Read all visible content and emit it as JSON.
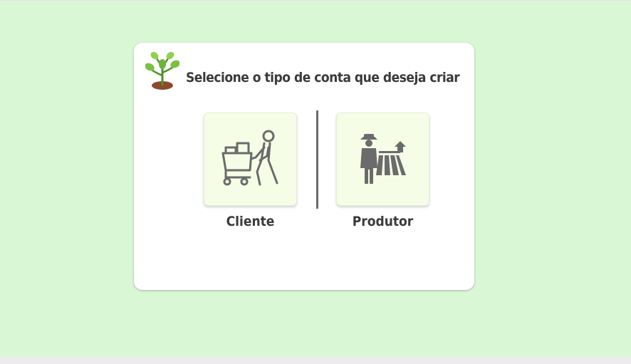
{
  "screen": {
    "title": "Selecione o tipo de conta que deseja criar",
    "options": [
      {
        "label": "Cliente",
        "icon": "shopping-cart-person-icon"
      },
      {
        "label": "Produtor",
        "icon": "farmer-icon"
      }
    ]
  },
  "colors": {
    "background": "#d9f7d4",
    "card": "#ffffff",
    "tile": "#f6fde6",
    "text": "#3a3a3a",
    "icon": "#6b6b6b"
  }
}
